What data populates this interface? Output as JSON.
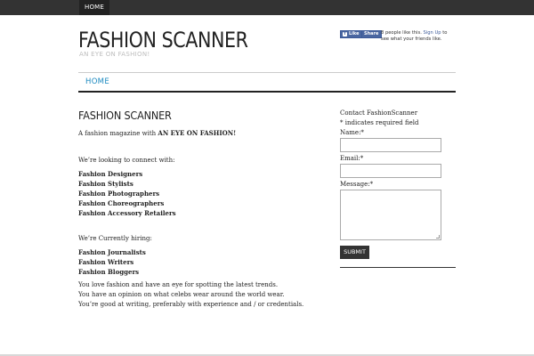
{
  "topbar": {
    "home_label": "HOME"
  },
  "site": {
    "title": "FASHION SCANNER",
    "tagline": "AN EYE ON FASHION!"
  },
  "facebook": {
    "like_label": "Like",
    "share_label": "Share",
    "text_prefix": "8 people like this.",
    "signup_label": "Sign Up",
    "text_suffix": "to see what your friends like."
  },
  "nav": {
    "home_label": "HOME"
  },
  "content": {
    "title": "FASHION SCANNER",
    "intro_prefix": "A fashion magazine with",
    "intro_bold": "AN EYE ON FASHION!",
    "connect_heading": "We’re looking to connect with:",
    "connect_list": [
      "Fashion Designers",
      "Fashion Stylists",
      "Fashion Photographers",
      "Fashion Choreographers",
      "Fashion Accessory Retailers"
    ],
    "hiring_heading": "We’re Currently hiring:",
    "hiring_list": [
      "Fashion Journalists",
      "Fashion Writers",
      "Fashion Bloggers"
    ],
    "closing_lines": [
      "You love fashion and have an eye for spotting the latest trends.",
      "You have an opinion on what celebs wear around the world wear.",
      "You’re good at writing, preferably with experience and / or credentials."
    ]
  },
  "sidebar": {
    "form_title": "Contact FashionScanner",
    "required_note": "* indicates required field",
    "name_label": "Name:*",
    "email_label": "Email:*",
    "message_label": "Message:*",
    "submit_label": "SUBMIT"
  }
}
